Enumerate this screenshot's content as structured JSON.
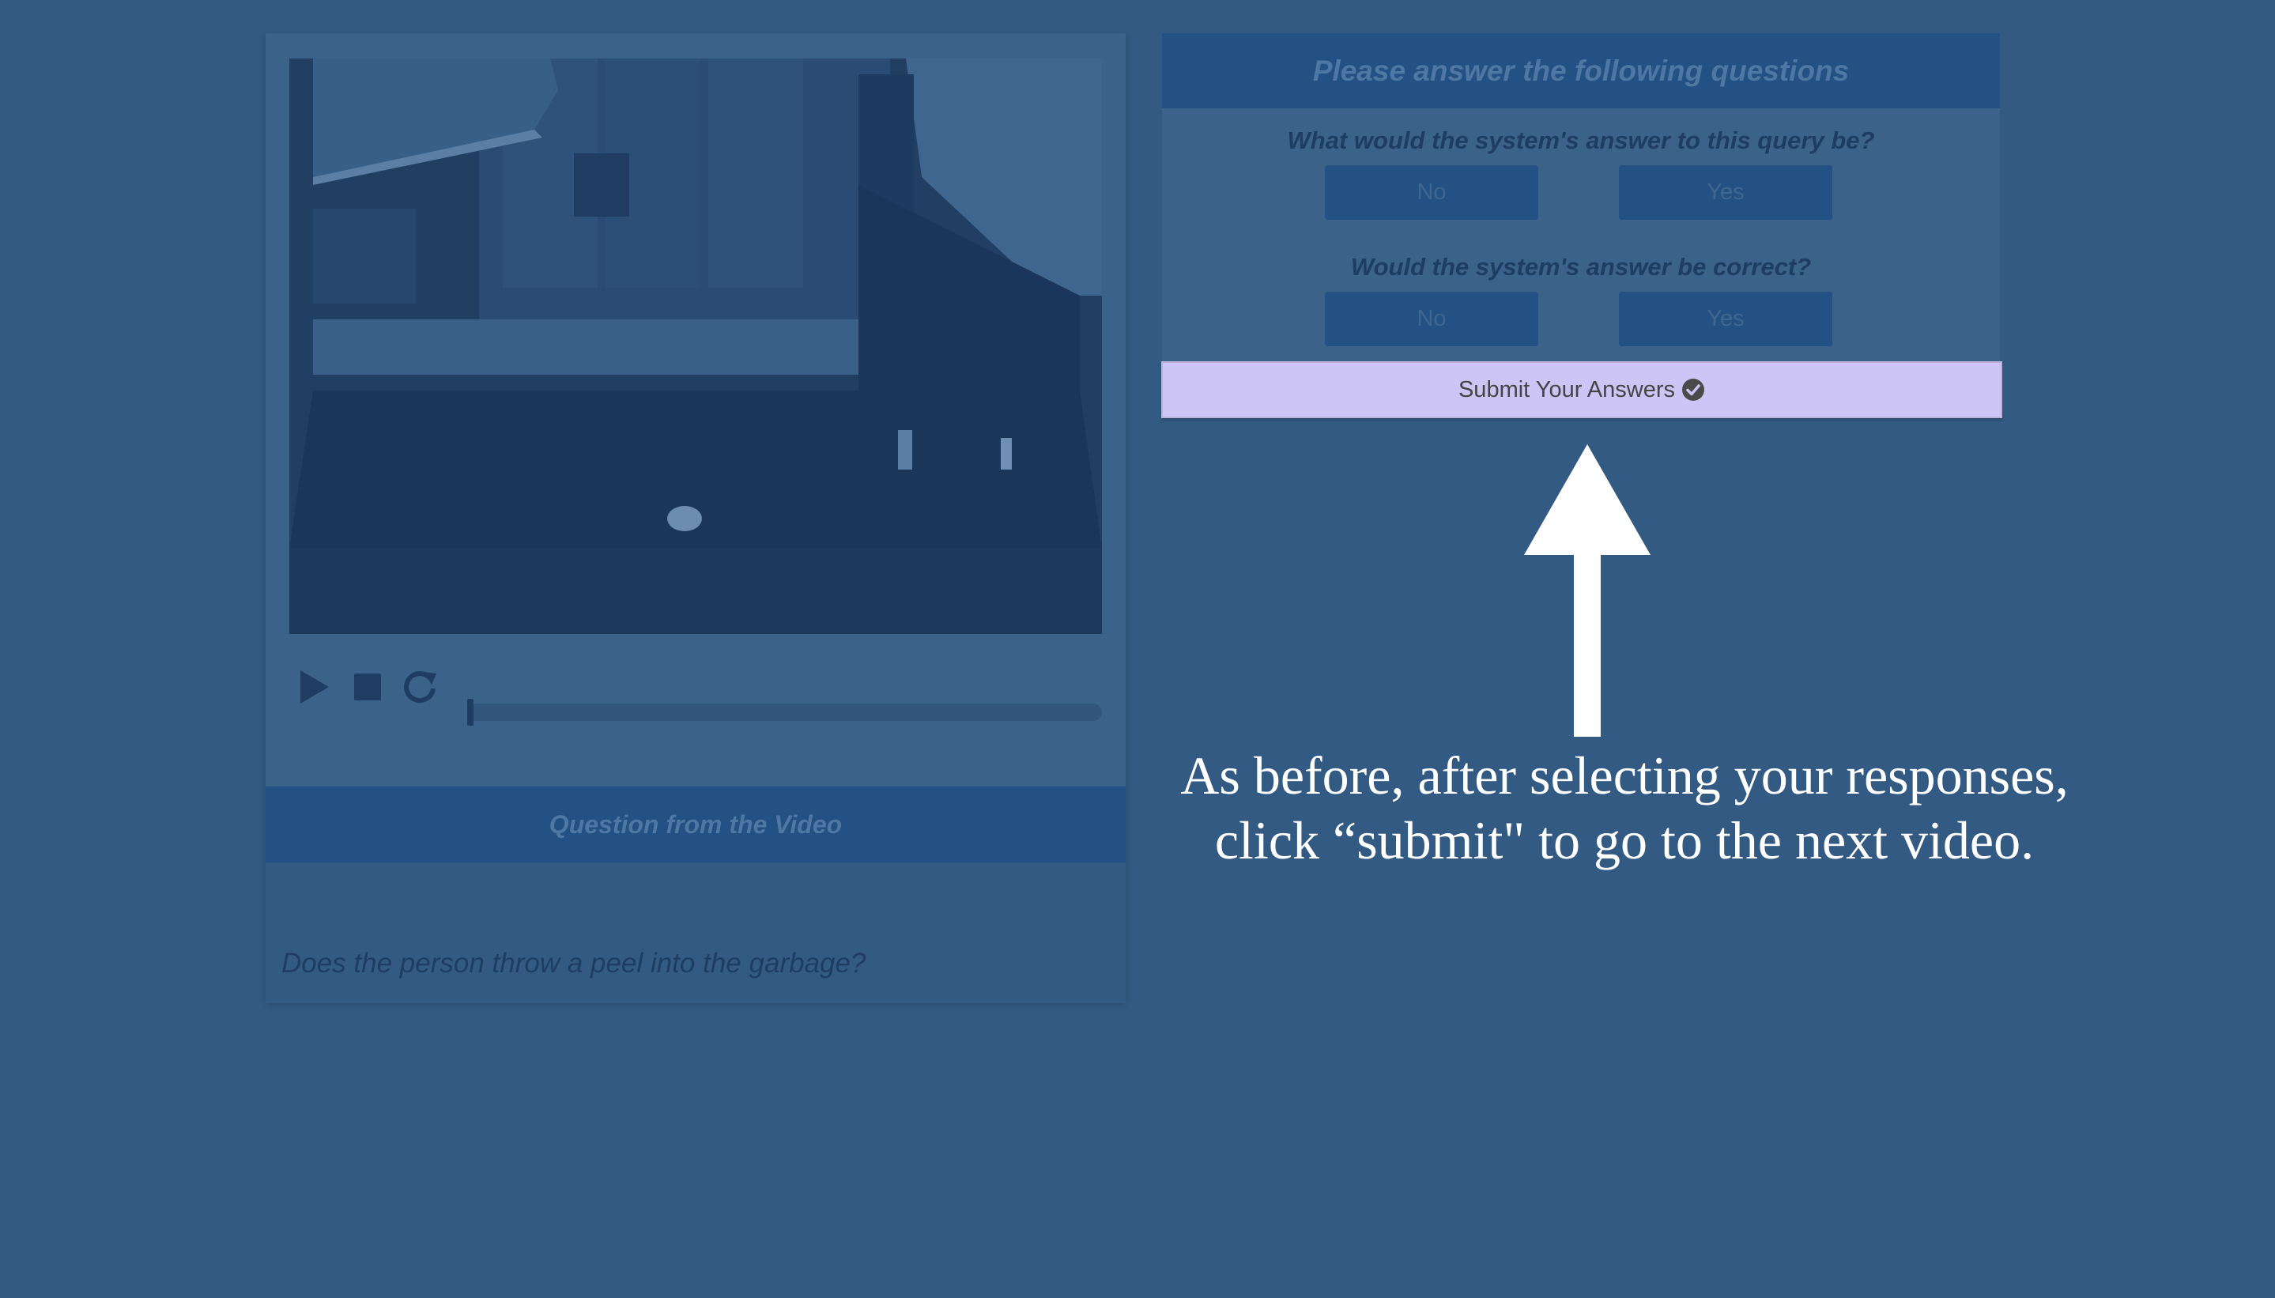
{
  "video_panel": {
    "video_question_header": "Question from the Video",
    "video_question_text": "Does the person throw a peel into the garbage?",
    "progress_fraction": 0.0
  },
  "question_panel": {
    "header": "Please answer the following questions",
    "q1": {
      "label": "What would the system's answer to this query be?",
      "no": "No",
      "yes": "Yes"
    },
    "q2": {
      "label": "Would the system's answer be correct?",
      "no": "No",
      "yes": "Yes"
    }
  },
  "submit": {
    "label": "Submit Your Answers"
  },
  "instruction": {
    "line1": "As before, after selecting your responses,",
    "line2": "click “submit\" to go to the next video."
  },
  "colors": {
    "overlay_bg": "#335a83",
    "submit_bg": "#cdc5f6",
    "arrow": "#ffffff"
  },
  "icons": [
    "play-icon",
    "stop-icon",
    "reload-icon",
    "check-circle-icon",
    "up-arrow"
  ]
}
